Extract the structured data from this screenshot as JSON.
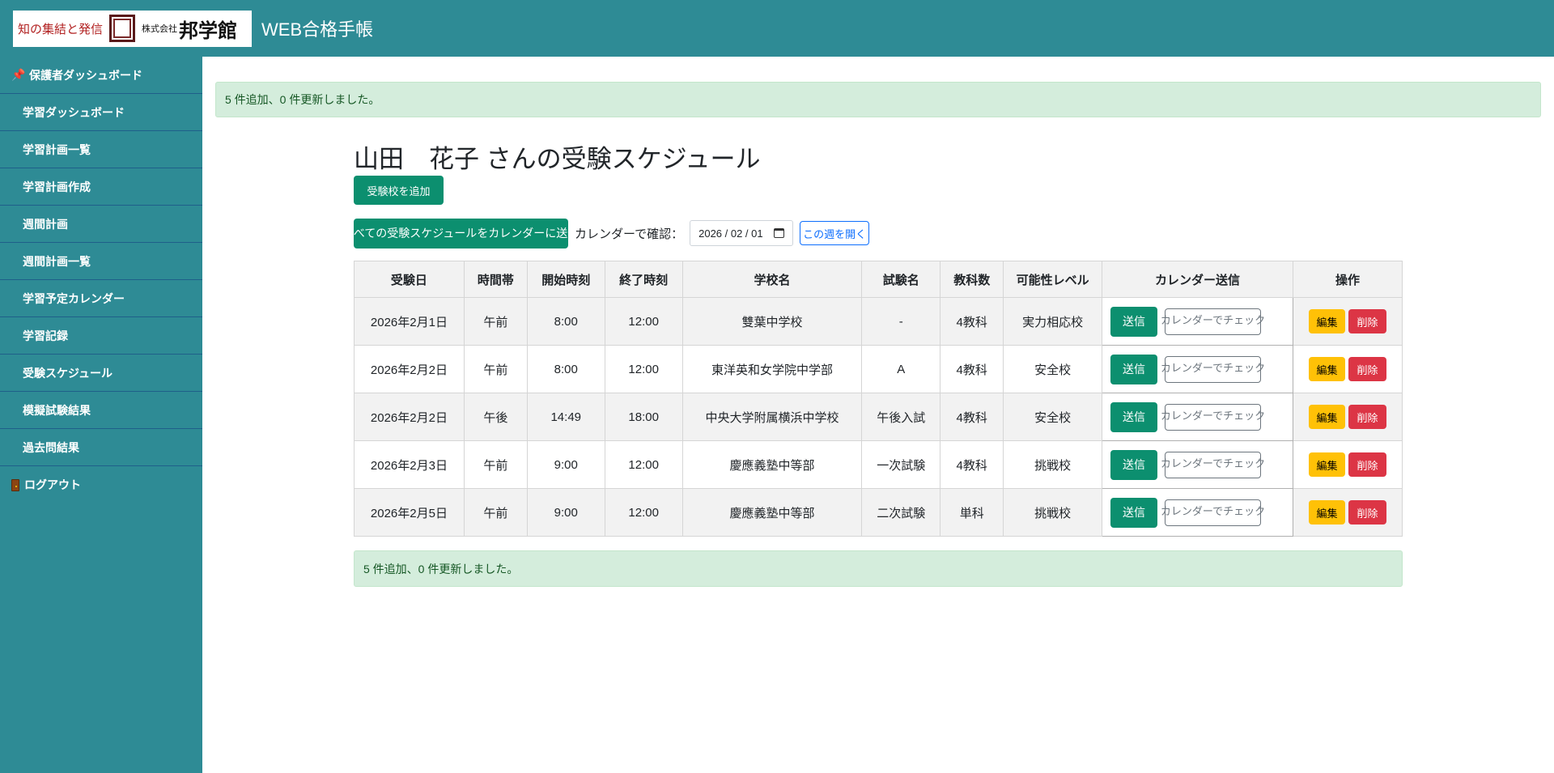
{
  "header": {
    "logo_left": "知の集結と発信",
    "logo_company": "株式会社",
    "logo_name": "邦学館",
    "app_title": "WEB合格手帳"
  },
  "sidebar": {
    "items": [
      {
        "label": "保護者ダッシュボード",
        "icon": "pushpin-icon"
      },
      {
        "label": "学習ダッシュボード"
      },
      {
        "label": "学習計画一覧"
      },
      {
        "label": "学習計画作成"
      },
      {
        "label": "週間計画"
      },
      {
        "label": "週間計画一覧"
      },
      {
        "label": "学習予定カレンダー"
      },
      {
        "label": "学習記録"
      },
      {
        "label": "受験スケジュール"
      },
      {
        "label": "模擬試験結果"
      },
      {
        "label": "過去問結果"
      },
      {
        "label": "ログアウト",
        "icon": "door-icon"
      }
    ]
  },
  "alerts": {
    "top": "5 件追加、0 件更新しました。",
    "bottom": "5 件追加、0 件更新しました。"
  },
  "page": {
    "title": "山田　花子 さんの受験スケジュール",
    "add_button": "受験校を追加",
    "send_all_button": "すべての受験スケジュールをカレンダーに送信",
    "calendar_label": "カレンダーで確認：",
    "calendar_date": "2026 / 02 / 01",
    "open_week_button": "この週を開く"
  },
  "table": {
    "headers": [
      "受験日",
      "時間帯",
      "開始時刻",
      "終了時刻",
      "学校名",
      "試験名",
      "教科数",
      "可能性レベル",
      "カレンダー送信",
      "操作"
    ],
    "send_label": "送信",
    "check_label": "カレンダーでチェック",
    "edit_label": "編集",
    "delete_label": "削除",
    "rows": [
      {
        "date": "2026年2月1日",
        "slot": "午前",
        "start": "8:00",
        "end": "12:00",
        "school": "雙葉中学校",
        "exam": "-",
        "subjects": "4教科",
        "level": "実力相応校"
      },
      {
        "date": "2026年2月2日",
        "slot": "午前",
        "start": "8:00",
        "end": "12:00",
        "school": "東洋英和女学院中学部",
        "exam": "A",
        "subjects": "4教科",
        "level": "安全校"
      },
      {
        "date": "2026年2月2日",
        "slot": "午後",
        "start": "14:49",
        "end": "18:00",
        "school": "中央大学附属横浜中学校",
        "exam": "午後入試",
        "subjects": "4教科",
        "level": "安全校"
      },
      {
        "date": "2026年2月3日",
        "slot": "午前",
        "start": "9:00",
        "end": "12:00",
        "school": "慶應義塾中等部",
        "exam": "一次試験",
        "subjects": "4教科",
        "level": "挑戦校"
      },
      {
        "date": "2026年2月5日",
        "slot": "午前",
        "start": "9:00",
        "end": "12:00",
        "school": "慶應義塾中等部",
        "exam": "二次試験",
        "subjects": "単科",
        "level": "挑戦校"
      }
    ]
  },
  "colors": {
    "brand_teal": "#2e8b95",
    "button_green": "#0c8f6f",
    "edit_yellow": "#ffc107",
    "delete_red": "#dc3545",
    "alert_bg": "#d4eddc"
  }
}
